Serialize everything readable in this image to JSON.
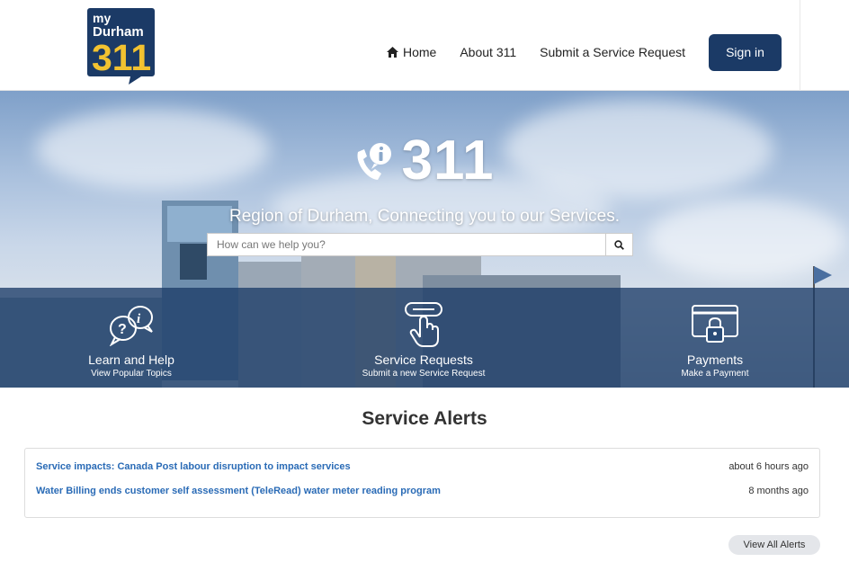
{
  "logo": {
    "line1": "my",
    "line2": "Durham",
    "line3": "311"
  },
  "nav": {
    "home_label": "Home",
    "about_label": "About 311",
    "submit_label": "Submit a Service Request",
    "signin_label": "Sign in"
  },
  "hero": {
    "title": "311",
    "subtitle": "Region of Durham, Connecting you to our Services.",
    "search_placeholder": "How can we help you?"
  },
  "tiles": [
    {
      "label": "Learn and Help",
      "sub": "View Popular Topics",
      "icon": "question-info-bubbles-icon"
    },
    {
      "label": "Service Requests",
      "sub": "Submit a new Service Request",
      "icon": "hand-pointer-icon"
    },
    {
      "label": "Payments",
      "sub": "Make a Payment",
      "icon": "card-lock-icon"
    }
  ],
  "alerts": {
    "title": "Service Alerts",
    "items": [
      {
        "text": "Service impacts: Canada Post labour disruption to impact services",
        "time": "about 6 hours ago"
      },
      {
        "text": "Water Billing ends customer self assessment (TeleRead) water meter reading program",
        "time": "8 months ago"
      }
    ],
    "view_all_label": "View All Alerts"
  },
  "colors": {
    "brand_navy": "#1b3a66",
    "logo_yellow": "#f2c230",
    "link_blue": "#2a6bb6"
  }
}
